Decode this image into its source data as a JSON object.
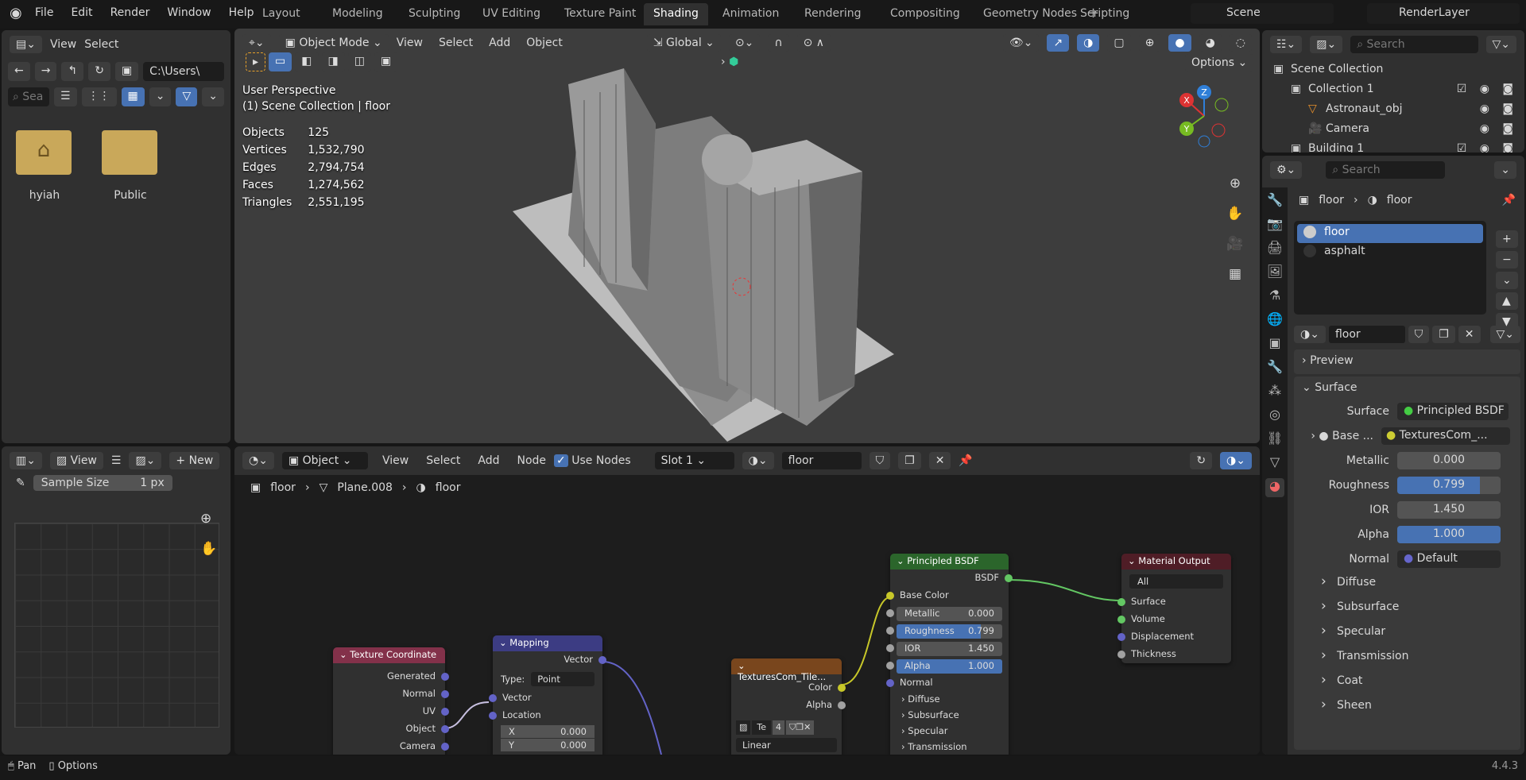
{
  "topbar": {
    "menus": [
      "File",
      "Edit",
      "Render",
      "Window",
      "Help"
    ],
    "workspaces": [
      "Layout",
      "Modeling",
      "Sculpting",
      "UV Editing",
      "Texture Paint",
      "Shading",
      "Animation",
      "Rendering",
      "Compositing",
      "Geometry Nodes",
      "Scripting"
    ],
    "active_workspace": "Shading",
    "scene": "Scene",
    "view_layer": "RenderLayer"
  },
  "file_browser": {
    "view": "View",
    "select": "Select",
    "path": "C:\\Users\\",
    "search_placeholder": "Sea",
    "items": [
      {
        "name": "hyiah",
        "icon": "home-folder-icon"
      },
      {
        "name": "Public",
        "icon": "folder-icon"
      }
    ]
  },
  "viewport": {
    "mode": "Object Mode",
    "menus": [
      "View",
      "Select",
      "Add",
      "Object"
    ],
    "orientation": "Global",
    "options": "Options",
    "title": "User Perspective",
    "subtitle": "(1) Scene Collection | floor",
    "stats": [
      [
        "Objects",
        "125"
      ],
      [
        "Vertices",
        "1,532,790"
      ],
      [
        "Edges",
        "2,794,754"
      ],
      [
        "Faces",
        "1,274,562"
      ],
      [
        "Triangles",
        "2,551,195"
      ]
    ],
    "gizmo": {
      "x": "X",
      "y": "Y",
      "z": "Z"
    }
  },
  "outliner": {
    "search_placeholder": "Search",
    "items": [
      {
        "name": "Scene Collection",
        "level": 0
      },
      {
        "name": "Collection 1",
        "level": 1
      },
      {
        "name": "Astronaut_obj",
        "level": 2
      },
      {
        "name": "Camera",
        "level": 2
      },
      {
        "name": "Building 1",
        "level": 1
      }
    ]
  },
  "image_editor": {
    "view": "View",
    "new": "New",
    "sample_label": "Sample Size",
    "sample_value": "1 px"
  },
  "node_editor": {
    "object": "Object",
    "menus": [
      "View",
      "Select",
      "Add",
      "Node"
    ],
    "use_nodes": "Use Nodes",
    "use_nodes_checked": true,
    "slot": "Slot 1",
    "material": "floor",
    "breadcrumb": [
      "floor",
      "Plane.008",
      "floor"
    ],
    "nodes": {
      "texcoord": {
        "title": "Texture Coordinate",
        "outputs": [
          "Generated",
          "Normal",
          "UV",
          "Object",
          "Camera"
        ],
        "color": "#83314a"
      },
      "mapping": {
        "title": "Mapping",
        "output": "Vector",
        "type_label": "Type:",
        "type_value": "Point",
        "inputs": [
          "Vector",
          "Location"
        ],
        "x_label": "X",
        "x_value": "0.000",
        "y_label": "Y",
        "y_value": "0.000",
        "color": "#3c3c83"
      },
      "image": {
        "title": "TexturesCom_Tile...",
        "outputs": [
          "Color",
          "Alpha"
        ],
        "image_name": "Te",
        "users": "4",
        "interpolation": "Linear",
        "color": "#79461d"
      },
      "bsdf": {
        "title": "Principled BSDF",
        "output": "BSDF",
        "base": "Base Color",
        "fields": [
          [
            "Metallic",
            "0.000",
            0
          ],
          [
            "Roughness",
            "0.799",
            0.799
          ],
          [
            "IOR",
            "1.450",
            0
          ],
          [
            "Alpha",
            "1.000",
            1
          ]
        ],
        "normal": "Normal",
        "panels": [
          "Diffuse",
          "Subsurface",
          "Specular",
          "Transmission"
        ],
        "color": "#2b652b"
      },
      "output": {
        "title": "Material Output",
        "target": "All",
        "inputs": [
          "Surface",
          "Volume",
          "Displacement",
          "Thickness"
        ],
        "color": "#4f1d26"
      }
    }
  },
  "properties": {
    "search_placeholder": "Search",
    "breadcrumb": [
      "floor",
      "floor"
    ],
    "slots": [
      "floor",
      "asphalt"
    ],
    "material": "floor",
    "preview": "Preview",
    "surface_panel": "Surface",
    "surface_label": "Surface",
    "surface_value": "Principled BSDF",
    "base_label": "Base ...",
    "base_value": "TexturesCom_...",
    "fields": [
      [
        "Metallic",
        "0.000",
        0
      ],
      [
        "Roughness",
        "0.799",
        0.799
      ],
      [
        "IOR",
        "1.450",
        0
      ],
      [
        "Alpha",
        "1.000",
        1
      ]
    ],
    "normal_label": "Normal",
    "normal_value": "Default",
    "subpanels": [
      "Diffuse",
      "Subsurface",
      "Specular",
      "Transmission",
      "Coat",
      "Sheen"
    ]
  },
  "statusbar": {
    "pan": "Pan",
    "options": "Options",
    "version": "4.4.3"
  }
}
